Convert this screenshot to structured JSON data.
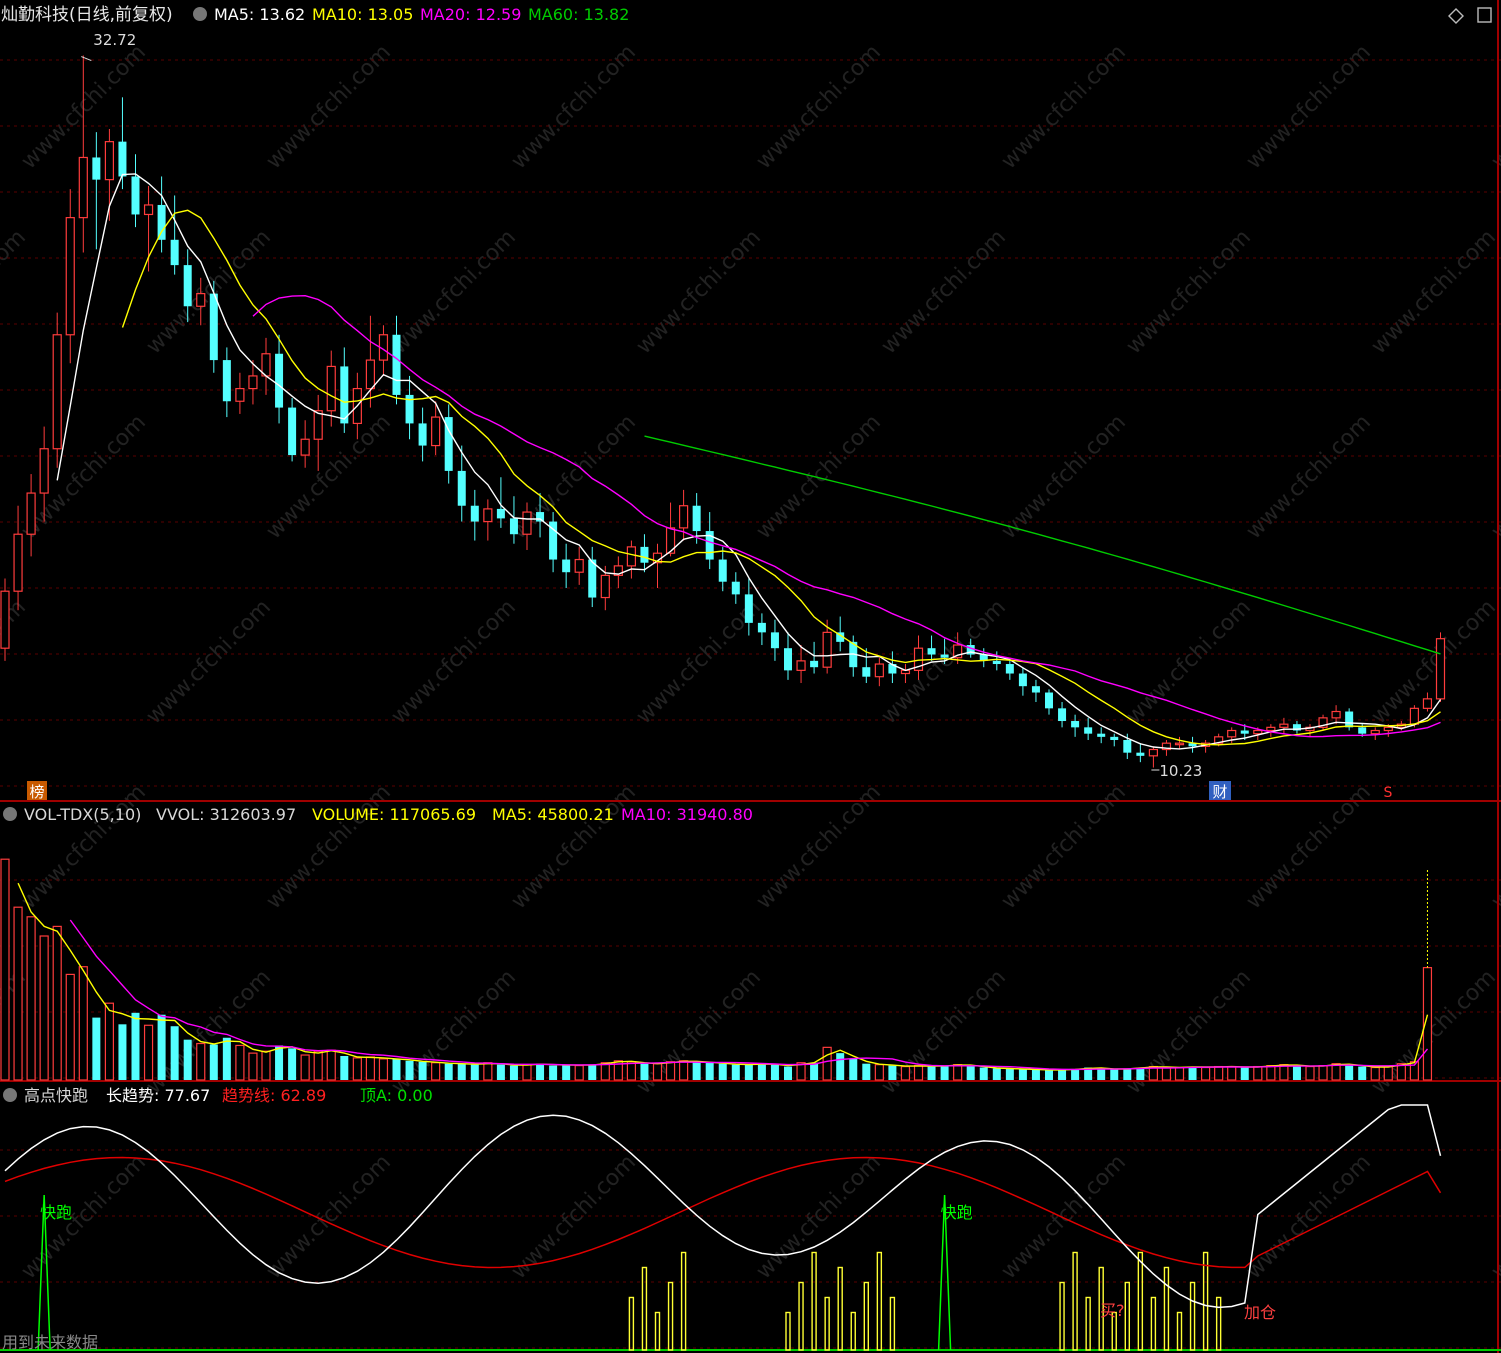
{
  "header": {
    "stock_name": "灿勤科技(日线,前复权)",
    "ma5": "MA5: 13.62",
    "ma10": "MA10: 13.05",
    "ma20": "MA20: 12.59",
    "ma60": "MA60: 13.82"
  },
  "volume_header": {
    "indicator": "VOL-TDX(5,10)",
    "vvol": "VVOL: 312603.97",
    "volume": "VOLUME: 117065.69",
    "ma5": "MA5: 45800.21",
    "ma10": "MA10: 31940.80"
  },
  "signal_header": {
    "indicator": "高点快跑",
    "long_trend": "长趋势: 77.67",
    "trend_line": "趋势线: 62.89",
    "top_a": "顶A: 0.00"
  },
  "price_annotations": {
    "high": "32.72",
    "low": "10.23",
    "badge_bang": "榜",
    "badge_cai": "财",
    "badge_s": "S"
  },
  "signal_annotations": {
    "kuaipao_1": "快跑",
    "kuaipao_2": "快跑",
    "maiqi": "买?",
    "jiacang": "加仓",
    "future_data": "用到未来数据"
  },
  "watermark": "www.cfchi.com",
  "colors": {
    "up": "#ff3c3c",
    "down": "#54ffff",
    "ma5": "#ffffff",
    "ma10": "#ffff00",
    "ma20": "#ff00ff",
    "ma60": "#00cc00",
    "trend": "#e00000",
    "signal": "#ffff33",
    "kuaipao": "#00ff00"
  },
  "chart_data": [
    {
      "type": "candlestick",
      "title": "灿勤科技(日线,前复权)",
      "series": [
        {
          "name": "MA5",
          "last": 13.62
        },
        {
          "name": "MA10",
          "last": 13.05
        },
        {
          "name": "MA20",
          "last": 12.59
        },
        {
          "name": "MA60",
          "last": 13.82
        }
      ],
      "ohlc": [
        [
          14.0,
          16.2,
          13.6,
          15.8
        ],
        [
          15.8,
          18.5,
          15.2,
          17.6
        ],
        [
          17.6,
          19.5,
          16.9,
          18.9
        ],
        [
          18.9,
          21.0,
          18.0,
          20.3
        ],
        [
          20.3,
          24.6,
          19.7,
          23.9
        ],
        [
          23.9,
          28.5,
          23.0,
          27.6
        ],
        [
          27.6,
          32.72,
          26.5,
          29.5
        ],
        [
          29.5,
          30.3,
          26.6,
          28.8
        ],
        [
          28.8,
          30.4,
          27.5,
          30.0
        ],
        [
          30.0,
          31.4,
          28.5,
          28.9
        ],
        [
          28.9,
          29.6,
          27.3,
          27.7
        ],
        [
          27.7,
          28.6,
          25.9,
          28.0
        ],
        [
          28.0,
          28.9,
          26.5,
          26.9
        ],
        [
          26.9,
          28.3,
          25.8,
          26.1
        ],
        [
          26.1,
          26.6,
          24.3,
          24.8
        ],
        [
          24.8,
          25.7,
          24.2,
          25.2
        ],
        [
          25.2,
          25.6,
          22.7,
          23.1
        ],
        [
          23.1,
          23.5,
          21.3,
          21.8
        ],
        [
          21.8,
          22.7,
          21.4,
          22.2
        ],
        [
          22.2,
          23.1,
          21.7,
          22.6
        ],
        [
          22.6,
          23.8,
          22.0,
          23.3
        ],
        [
          23.3,
          23.9,
          21.1,
          21.6
        ],
        [
          21.6,
          21.9,
          19.9,
          20.1
        ],
        [
          20.1,
          21.2,
          19.7,
          20.6
        ],
        [
          20.6,
          22.0,
          19.6,
          21.5
        ],
        [
          21.5,
          23.4,
          21.0,
          22.9
        ],
        [
          22.9,
          23.5,
          20.8,
          21.1
        ],
        [
          21.1,
          22.7,
          20.6,
          22.2
        ],
        [
          22.2,
          24.5,
          21.6,
          23.1
        ],
        [
          23.1,
          24.2,
          22.6,
          23.9
        ],
        [
          23.9,
          24.5,
          21.7,
          22.0
        ],
        [
          22.0,
          22.6,
          20.6,
          21.1
        ],
        [
          21.1,
          21.6,
          19.9,
          20.4
        ],
        [
          20.4,
          21.8,
          20.1,
          21.3
        ],
        [
          21.3,
          21.7,
          19.2,
          19.6
        ],
        [
          19.6,
          20.4,
          18.0,
          18.5
        ],
        [
          18.5,
          19.0,
          17.4,
          18.0
        ],
        [
          18.0,
          18.7,
          17.4,
          18.4
        ],
        [
          18.4,
          19.4,
          17.8,
          18.1
        ],
        [
          18.1,
          18.8,
          17.3,
          17.6
        ],
        [
          17.6,
          18.6,
          17.1,
          18.3
        ],
        [
          18.3,
          18.9,
          17.5,
          18.0
        ],
        [
          18.0,
          18.3,
          16.4,
          16.8
        ],
        [
          16.8,
          17.3,
          15.9,
          16.4
        ],
        [
          16.4,
          17.2,
          16.0,
          16.8
        ],
        [
          16.8,
          17.2,
          15.3,
          15.6
        ],
        [
          15.6,
          16.6,
          15.2,
          16.3
        ],
        [
          16.3,
          16.9,
          15.9,
          16.6
        ],
        [
          16.6,
          17.4,
          16.2,
          17.2
        ],
        [
          17.2,
          17.6,
          16.4,
          16.7
        ],
        [
          16.7,
          17.3,
          15.9,
          17.0
        ],
        [
          17.0,
          18.6,
          16.9,
          17.8
        ],
        [
          17.8,
          19.0,
          17.4,
          18.5
        ],
        [
          18.5,
          18.9,
          17.3,
          17.7
        ],
        [
          17.7,
          18.3,
          16.5,
          16.8
        ],
        [
          16.8,
          17.2,
          15.8,
          16.1
        ],
        [
          16.1,
          16.4,
          15.4,
          15.7
        ],
        [
          15.7,
          16.2,
          14.4,
          14.8
        ],
        [
          14.8,
          15.1,
          14.1,
          14.5
        ],
        [
          14.5,
          14.9,
          13.6,
          14.0
        ],
        [
          14.0,
          14.5,
          13.0,
          13.3
        ],
        [
          13.3,
          14.1,
          12.9,
          13.6
        ],
        [
          13.6,
          14.2,
          13.2,
          13.4
        ],
        [
          13.4,
          14.9,
          13.2,
          14.5
        ],
        [
          14.5,
          15.0,
          13.9,
          14.2
        ],
        [
          14.2,
          14.4,
          13.1,
          13.4
        ],
        [
          13.4,
          14.0,
          12.9,
          13.1
        ],
        [
          13.1,
          13.7,
          12.8,
          13.5
        ],
        [
          13.5,
          13.9,
          12.9,
          13.2
        ],
        [
          13.2,
          13.5,
          12.9,
          13.3
        ],
        [
          13.3,
          14.4,
          13.0,
          14.0
        ],
        [
          14.0,
          14.4,
          13.6,
          13.8
        ],
        [
          13.8,
          14.3,
          13.5,
          13.7
        ],
        [
          13.7,
          14.5,
          13.5,
          14.1
        ],
        [
          14.1,
          14.3,
          13.7,
          13.8
        ],
        [
          13.8,
          14.0,
          13.4,
          13.6
        ],
        [
          13.6,
          13.9,
          13.3,
          13.5
        ],
        [
          13.5,
          13.7,
          13.0,
          13.2
        ],
        [
          13.2,
          13.4,
          12.5,
          12.8
        ],
        [
          12.8,
          13.0,
          12.3,
          12.6
        ],
        [
          12.6,
          12.7,
          11.9,
          12.1
        ],
        [
          12.1,
          12.3,
          11.5,
          11.7
        ],
        [
          11.7,
          11.9,
          11.2,
          11.5
        ],
        [
          11.5,
          11.8,
          11.1,
          11.3
        ],
        [
          11.3,
          11.5,
          11.0,
          11.2
        ],
        [
          11.2,
          11.3,
          10.9,
          11.1
        ],
        [
          11.1,
          11.3,
          10.5,
          10.7
        ],
        [
          10.7,
          11.0,
          10.4,
          10.6
        ],
        [
          10.6,
          10.9,
          10.23,
          10.8
        ],
        [
          10.8,
          11.1,
          10.6,
          11.0
        ],
        [
          11.0,
          11.2,
          10.8,
          11.0
        ],
        [
          11.0,
          11.2,
          10.7,
          10.9
        ],
        [
          10.9,
          11.1,
          10.7,
          11.0
        ],
        [
          11.0,
          11.3,
          10.9,
          11.2
        ],
        [
          11.2,
          11.5,
          11.0,
          11.4
        ],
        [
          11.4,
          11.6,
          11.1,
          11.3
        ],
        [
          11.3,
          11.5,
          11.1,
          11.4
        ],
        [
          11.4,
          11.6,
          11.2,
          11.5
        ],
        [
          11.5,
          11.8,
          11.3,
          11.6
        ],
        [
          11.6,
          11.7,
          11.3,
          11.4
        ],
        [
          11.4,
          11.6,
          11.2,
          11.5
        ],
        [
          11.5,
          11.9,
          11.4,
          11.8
        ],
        [
          11.8,
          12.2,
          11.6,
          12.0
        ],
        [
          12.0,
          12.1,
          11.4,
          11.5
        ],
        [
          11.5,
          11.6,
          11.2,
          11.3
        ],
        [
          11.3,
          11.5,
          11.1,
          11.4
        ],
        [
          11.4,
          11.6,
          11.2,
          11.5
        ],
        [
          11.5,
          11.7,
          11.4,
          11.6
        ],
        [
          11.6,
          12.2,
          11.5,
          12.1
        ],
        [
          12.1,
          12.6,
          12.0,
          12.4
        ],
        [
          12.4,
          14.5,
          12.3,
          14.3
        ]
      ]
    },
    {
      "type": "bar",
      "title": "VOL-TDX(5,10)",
      "series": [
        {
          "name": "VVOL",
          "last": 312603.97
        },
        {
          "name": "VOLUME",
          "last": 117065.69
        },
        {
          "name": "MA5",
          "last": 45800.21
        },
        {
          "name": "MA10",
          "last": 31940.8
        }
      ],
      "volume": [
        230000,
        180000,
        170000,
        150000,
        160000,
        110000,
        118000,
        65000,
        80000,
        58000,
        70000,
        57000,
        68000,
        56000,
        42000,
        38000,
        37000,
        44000,
        36000,
        28000,
        30000,
        36000,
        33000,
        26000,
        30000,
        31000,
        25000,
        23000,
        24000,
        22000,
        22000,
        20000,
        19000,
        18000,
        17000,
        17000,
        16000,
        18000,
        16000,
        15000,
        16000,
        17000,
        15000,
        16000,
        15000,
        16000,
        18000,
        20000,
        19000,
        17000,
        17000,
        19000,
        20000,
        19000,
        18000,
        17000,
        16000,
        16000,
        17000,
        16000,
        14000,
        18000,
        18000,
        34000,
        28000,
        22000,
        17000,
        16000,
        15000,
        14000,
        15000,
        14000,
        15000,
        16000,
        15000,
        13000,
        12000,
        12000,
        11000,
        11000,
        10000,
        11000,
        11000,
        13000,
        12000,
        11000,
        12000,
        13000,
        14000,
        13000,
        13000,
        14000,
        13000,
        14000,
        14000,
        13000,
        14000,
        15000,
        16000,
        15000,
        14000,
        15000,
        17000,
        16000,
        14000,
        13000,
        14000,
        17000,
        19000,
        117065.69
      ]
    },
    {
      "type": "line",
      "title": "高点快跑",
      "series": [
        {
          "name": "长趋势",
          "last": 77.67
        },
        {
          "name": "趋势线",
          "last": 62.89
        },
        {
          "name": "顶A",
          "last": 0.0
        }
      ]
    }
  ]
}
